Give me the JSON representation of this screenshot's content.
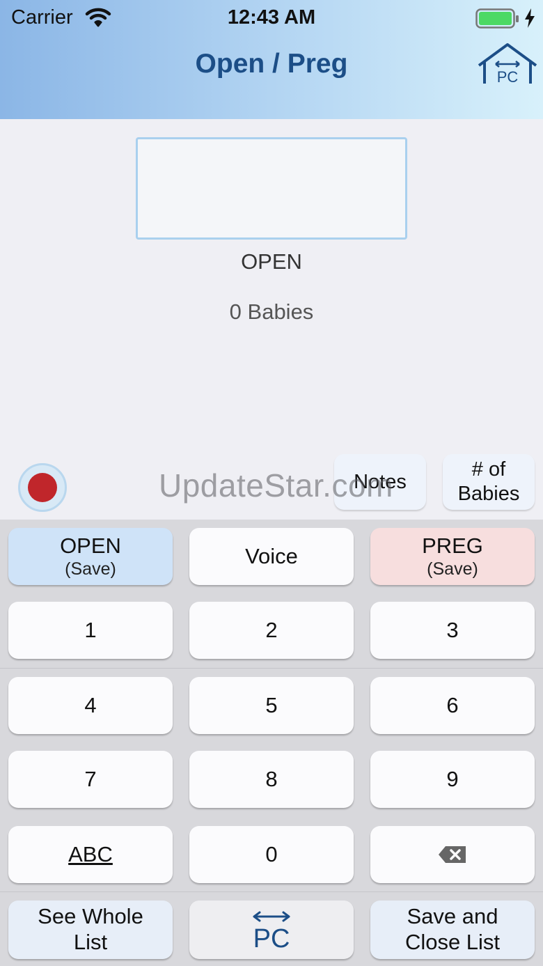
{
  "status_bar": {
    "carrier": "Carrier",
    "time": "12:43 AM",
    "battery_color": "#4cd964"
  },
  "nav": {
    "title": "Open / Preg",
    "home_icon_text": "PC"
  },
  "content": {
    "entry_value": "",
    "status": "OPEN",
    "babies": "0 Babies"
  },
  "chips": {
    "notes": "Notes",
    "babies_line1": "# of",
    "babies_line2": "Babies"
  },
  "watermark": "UpdateStar.com",
  "keypad": {
    "open_label": "OPEN",
    "open_sub": "(Save)",
    "voice": "Voice",
    "preg_label": "PREG",
    "preg_sub": "(Save)",
    "digits": [
      "1",
      "2",
      "3",
      "4",
      "5",
      "6",
      "7",
      "8",
      "9"
    ],
    "abc": "ABC",
    "zero": "0",
    "see_whole_1": "See Whole",
    "see_whole_2": "List",
    "pc_text": "PC",
    "save_close_1": "Save and",
    "save_close_2": "Close List"
  },
  "colors": {
    "title": "#1c4e87",
    "record": "#c0262b",
    "open_key": "#cfe3f8",
    "preg_key": "#f7dede"
  }
}
